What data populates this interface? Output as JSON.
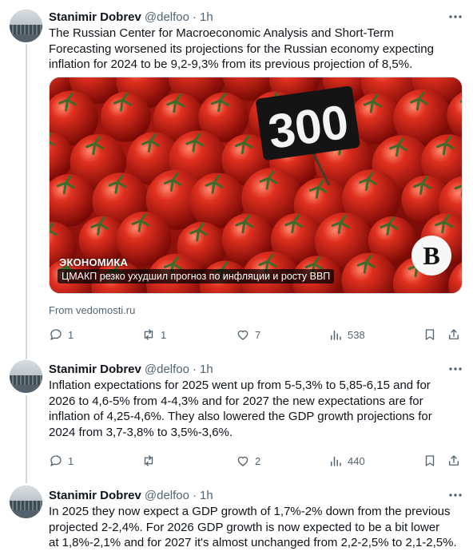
{
  "tweets": [
    {
      "author": "Stanimir Dobrev",
      "handle": "@delfoo",
      "dot": "·",
      "time": "1h",
      "text": "The Russian  Center for Macroeconomic Analysis and Short-Term\nForecasting worsened its projections for the Russian economy expecting\ninflation for 2024 to be 9,2-9,3% from its previous projection of 8,5%.",
      "media": {
        "price_tag": "300",
        "section_label": "ЭКОНОМИКА",
        "caption": "ЦМАКП резко ухудшил прогноз по инфляции и росту ВВП",
        "logo": "B"
      },
      "source": "From vedomosti.ru",
      "stats": {
        "replies": "1",
        "reposts": "1",
        "likes": "7",
        "views": "538"
      }
    },
    {
      "author": "Stanimir Dobrev",
      "handle": "@delfoo",
      "dot": "·",
      "time": "1h",
      "text": "Inflation expectations for 2025 went up from 5-5,3% to 5,85-6,15 and for\n2026 to 4,6-5% from 4-4,3% and for 2027 the new expectations are for\ninflation of 4,25-4,6%. They also lowered the GDP growth projections for\n2024 from 3,7-3,8% to 3,5%-3,6%.",
      "stats": {
        "replies": "1",
        "reposts": "",
        "likes": "2",
        "views": "440"
      }
    },
    {
      "author": "Stanimir Dobrev",
      "handle": "@delfoo",
      "dot": "·",
      "time": "1h",
      "text": "In 2025 they now expect a GDP growth of 1,7%-2% down from the previous\nprojected 2-2,4%. For 2026 GDP growth is now expected to be a bit lower\nat 1,8%-2,1% and for 2027 it's almost unchanged from 2,2-2,5% to 2,1-2,5%."
    }
  ],
  "colors": {
    "text": "#0f1419",
    "muted": "#536471",
    "thread_line": "#cfd9de",
    "tomato": "#c8231a"
  }
}
